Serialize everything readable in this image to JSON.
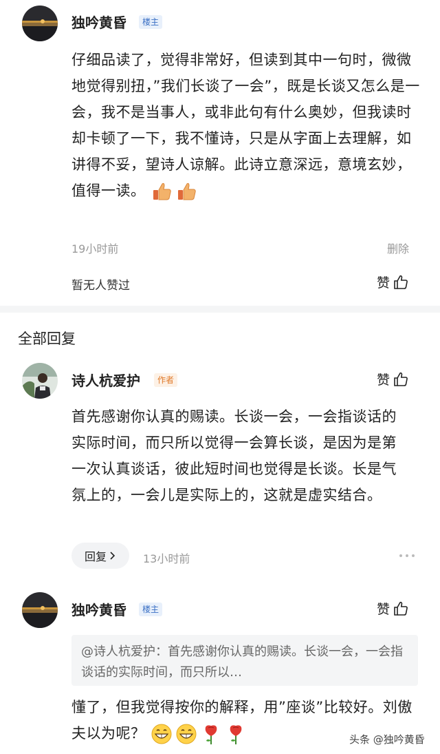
{
  "comment": {
    "author": "独吟黄昏",
    "badge": "楼主",
    "text": "仔细品读了，觉得非常好，但读到其中一句时，微微地觉得别扭，”我们长谈了一会”，既是长谈又怎么是一会，我不是当事人，或非此句有什么奥妙，但我读时却卡顿了一下，我不懂诗，只是从字面上去理解，如讲得不妥，望诗人谅解。此诗立意深远，意境玄妙，值得一读。",
    "emojis": [
      "thumbs-up-icon",
      "thumbs-up-icon"
    ],
    "time": "19小时前",
    "delete_label": "删除",
    "no_likes": "暂无人赞过",
    "like_label": "赞"
  },
  "replies_section": {
    "title": "全部回复"
  },
  "reply1": {
    "author": "诗人杭爱护",
    "badge": "作者",
    "like_label": "赞",
    "text": "首先感谢你认真的赐读。长谈一会，一会指谈话的实际时间，而只所以觉得一会算长谈，是因为是第一次认真谈话，彼此短时间也觉得是长谈。长是气氛上的，一会儿是实际上的，这就是虚实结合。",
    "reply_button": "回复",
    "time": "13小时前"
  },
  "reply2": {
    "author": "独吟黄昏",
    "badge": "楼主",
    "like_label": "赞",
    "quote": "@诗人杭爱护：首先感谢你认真的赐读。长谈一会，一会指谈话的实际时间，而只所以…",
    "text": "懂了，但我觉得按你的解释，用”座谈”比较好。刘傲夫以为呢？",
    "emojis": [
      "grin-icon",
      "grin-icon",
      "rose-icon",
      "rose-icon"
    ]
  },
  "watermark": "头条 @独吟黄昏",
  "colors": {
    "host_badge": "#3a6fc4",
    "author_badge": "#e07a2a",
    "meta": "#999999"
  }
}
